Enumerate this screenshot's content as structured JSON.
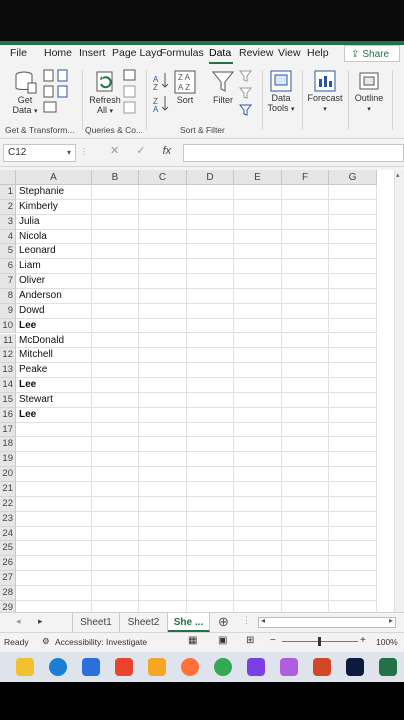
{
  "ribbon_tabs": [
    "File",
    "Home",
    "Insert",
    "Page Layc",
    "Formulas",
    "Data",
    "Review",
    "View",
    "Help"
  ],
  "active_tab": "Data",
  "share_label": "Share",
  "ribbon": {
    "get_data": "Get Data",
    "refresh_all": "Refresh All",
    "sort": "Sort",
    "filter": "Filter",
    "data_tools": "Data Tools",
    "forecast": "Forecast",
    "outline": "Outline",
    "groups": {
      "get_transform": "Get & Transform...",
      "queries": "Queries & Co...",
      "sort_filter": "Sort & Filter"
    }
  },
  "formula_bar": {
    "name_box": "C12",
    "fx": "fx",
    "value": ""
  },
  "columns": [
    "A",
    "B",
    "C",
    "D",
    "E",
    "F",
    "G"
  ],
  "rows": [
    {
      "num": "1",
      "a": "Stephanie",
      "bold": false
    },
    {
      "num": "2",
      "a": "Kimberly",
      "bold": false
    },
    {
      "num": "3",
      "a": "Julia",
      "bold": false
    },
    {
      "num": "4",
      "a": "Nicola",
      "bold": false
    },
    {
      "num": "5",
      "a": "Leonard",
      "bold": false
    },
    {
      "num": "6",
      "a": "Liam",
      "bold": false
    },
    {
      "num": "7",
      "a": "Oliver",
      "bold": false
    },
    {
      "num": "8",
      "a": "Anderson",
      "bold": false
    },
    {
      "num": "9",
      "a": "Dowd",
      "bold": false
    },
    {
      "num": "10",
      "a": "Lee",
      "bold": true
    },
    {
      "num": "11",
      "a": "McDonald",
      "bold": false
    },
    {
      "num": "12",
      "a": "Mitchell",
      "bold": false
    },
    {
      "num": "13",
      "a": "Peake",
      "bold": false
    },
    {
      "num": "14",
      "a": "Lee",
      "bold": true
    },
    {
      "num": "15",
      "a": "Stewart",
      "bold": false
    },
    {
      "num": "16",
      "a": "Lee",
      "bold": true
    },
    {
      "num": "17",
      "a": "",
      "bold": false
    },
    {
      "num": "18",
      "a": "",
      "bold": false
    },
    {
      "num": "19",
      "a": "",
      "bold": false
    },
    {
      "num": "20",
      "a": "",
      "bold": false
    },
    {
      "num": "21",
      "a": "",
      "bold": false
    },
    {
      "num": "22",
      "a": "",
      "bold": false
    },
    {
      "num": "23",
      "a": "",
      "bold": false
    },
    {
      "num": "24",
      "a": "",
      "bold": false
    },
    {
      "num": "25",
      "a": "",
      "bold": false
    },
    {
      "num": "26",
      "a": "",
      "bold": false
    },
    {
      "num": "27",
      "a": "",
      "bold": false
    },
    {
      "num": "28",
      "a": "",
      "bold": false
    },
    {
      "num": "29",
      "a": "",
      "bold": false
    }
  ],
  "sheet_tabs": [
    "Sheet1",
    "Sheet2",
    "She ..."
  ],
  "active_sheet": "She ...",
  "status": {
    "ready": "Ready",
    "accessibility": "Accessibility: Investigate",
    "zoom": "100%"
  },
  "taskbar_apps": [
    "file-explorer",
    "edge",
    "store",
    "wps",
    "chrome-canary",
    "firefox",
    "chrome",
    "clipchamp",
    "copilot",
    "powerpoint",
    "photoshop",
    "excel"
  ]
}
